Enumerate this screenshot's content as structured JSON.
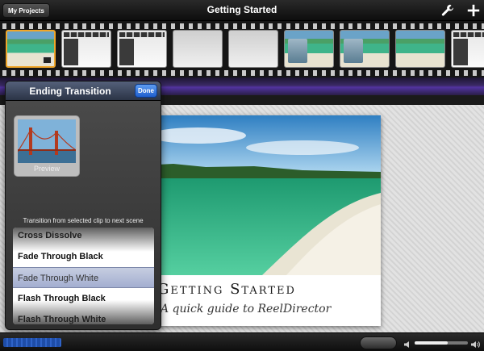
{
  "toolbar": {
    "my_projects_label": "My Projects",
    "title": "Getting Started",
    "settings_icon": "wrench-icon",
    "add_icon": "plus-icon"
  },
  "filmstrip": {
    "clips": [
      {
        "kind": "beach",
        "selected": true
      },
      {
        "kind": "ui"
      },
      {
        "kind": "ui"
      },
      {
        "kind": "grey"
      },
      {
        "kind": "grey"
      },
      {
        "kind": "pelican"
      },
      {
        "kind": "pelican"
      },
      {
        "kind": "beach"
      },
      {
        "kind": "ui"
      }
    ]
  },
  "popover": {
    "title": "Ending Transition",
    "done_label": "Done",
    "preview_label": "Preview",
    "hint": "Transition from selected clip to next scene",
    "options": [
      "Cross Dissolve",
      "Fade Through Black",
      "Fade Through White",
      "Flash Through Black",
      "Flash Through White"
    ],
    "selected_index": 2
  },
  "card": {
    "title": "Getting Started",
    "subtitle": "A quick guide to ReelDirector"
  },
  "playback": {
    "volume_fraction": 0.62
  },
  "colors": {
    "accent": "#f0a62a",
    "band": "#5233a0",
    "done": "#1f5fcf"
  }
}
